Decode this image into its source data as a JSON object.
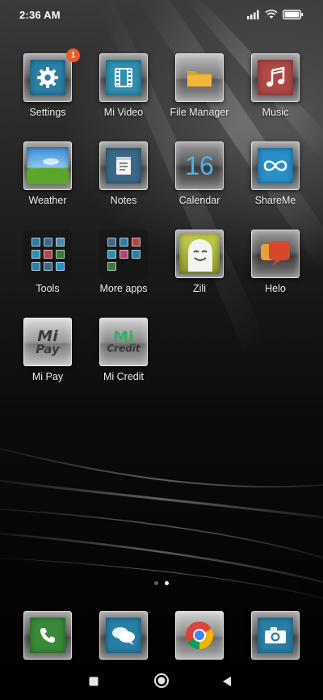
{
  "status_bar": {
    "time": "2:36 AM",
    "icons": [
      "signal-icon",
      "wifi-icon",
      "battery-icon"
    ]
  },
  "apps": [
    {
      "label": "Settings",
      "icon": "gear-icon",
      "badge": "1",
      "color": "#2a7fa5"
    },
    {
      "label": "Mi Video",
      "icon": "film-icon",
      "color": "#2f8fb0"
    },
    {
      "label": "File Manager",
      "icon": "folder-icon",
      "color": "#d9a02e"
    },
    {
      "label": "Music",
      "icon": "music-note-icon",
      "color": "#b04848"
    },
    {
      "label": "Weather",
      "icon": "landscape-icon",
      "color": "#3d8fd9"
    },
    {
      "label": "Notes",
      "icon": "notepad-icon",
      "color": "#3a6a88"
    },
    {
      "label": "Calendar",
      "icon": "calendar-icon",
      "calendar_day": "16",
      "color": "#2a7fa5"
    },
    {
      "label": "ShareMe",
      "icon": "infinity-icon",
      "color": "#2a8fc7"
    },
    {
      "label": "Tools",
      "icon": "folder-icon",
      "color": "#1a1a1a"
    },
    {
      "label": "More apps",
      "icon": "folder-icon",
      "color": "#1a1a1a"
    },
    {
      "label": "Zili",
      "icon": "ghost-face-icon",
      "color": "#b9c44a"
    },
    {
      "label": "Helo",
      "icon": "chat-bubble-icon",
      "color": "#d0503a"
    },
    {
      "label": "Mi Pay",
      "icon": "mi-pay-logo-icon",
      "logo_line1": "Mi",
      "logo_line2": "Pay",
      "color": "#5a5a5a"
    },
    {
      "label": "Mi Credit",
      "icon": "mi-credit-logo-icon",
      "logo_line1": "Mi",
      "logo_line2": "Credit",
      "color": "#4a4a4a"
    }
  ],
  "page_indicator": {
    "pages": 2,
    "active": 2
  },
  "dock": [
    {
      "icon": "phone-icon",
      "color": "#3a8a3a"
    },
    {
      "icon": "messages-icon",
      "color": "#2a7fa5"
    },
    {
      "icon": "chrome-icon",
      "color": "#e0e0e0"
    },
    {
      "icon": "camera-icon",
      "color": "#2a7fa5"
    }
  ],
  "nav": [
    "recents-square-icon",
    "home-circle-icon",
    "back-triangle-icon"
  ]
}
